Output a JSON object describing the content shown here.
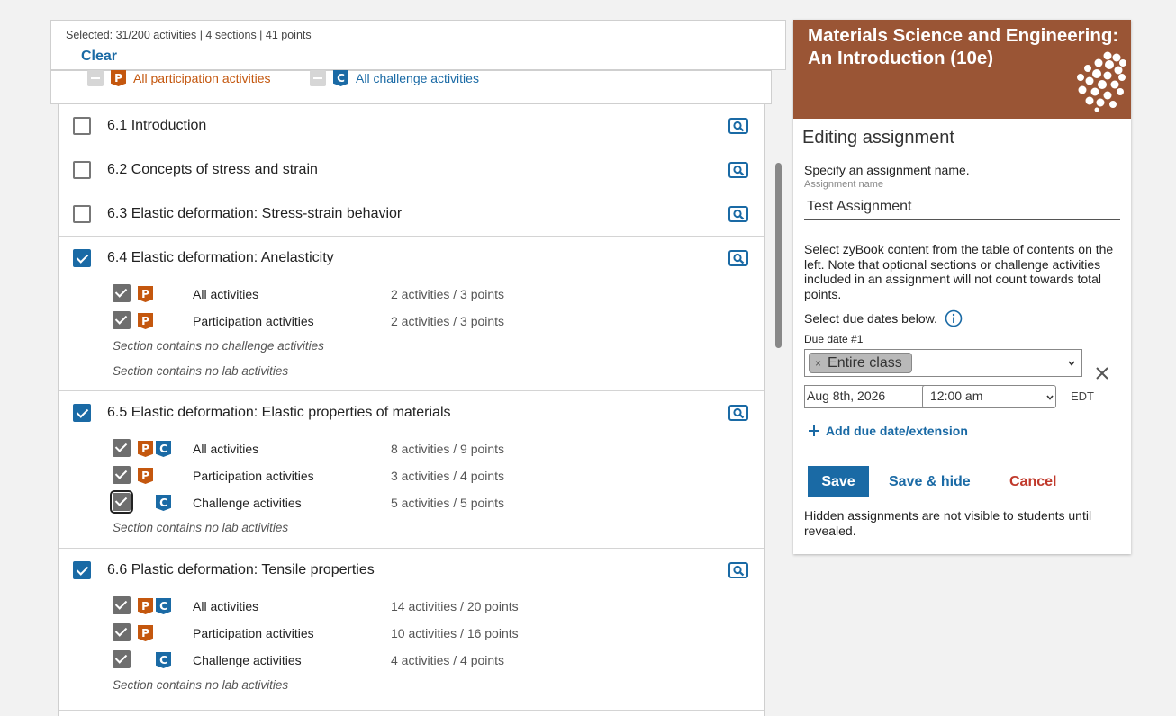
{
  "selection": {
    "summary": "Selected: 31/200 activities | 4 sections | 41 points",
    "clear_label": "Clear"
  },
  "filters": {
    "participation_label": "All participation activities",
    "challenge_label": "All challenge activities",
    "participation_badge": "P",
    "challenge_badge": "C",
    "participation_color": "#c4570e",
    "challenge_color": "#1a6aa5"
  },
  "sections": [
    {
      "title": "6.1 Introduction",
      "checked": false
    },
    {
      "title": "6.2 Concepts of stress and strain",
      "checked": false
    },
    {
      "title": "6.3 Elastic deformation: Stress-strain behavior",
      "checked": false
    },
    {
      "title": "6.4 Elastic deformation: Anelasticity",
      "checked": true,
      "activities": [
        {
          "label": "All activities",
          "count": "2 activities / 3 points"
        },
        {
          "label": "Participation activities",
          "count": "2 activities / 3 points"
        }
      ],
      "notes": [
        "Section contains no challenge activities",
        "Section contains no lab activities"
      ]
    },
    {
      "title": "6.5 Elastic deformation: Elastic properties of materials",
      "checked": true,
      "activities": [
        {
          "label": "All activities",
          "count": "8 activities / 9 points"
        },
        {
          "label": "Participation activities",
          "count": "3 activities / 4 points"
        },
        {
          "label": "Challenge activities",
          "count": "5 activities / 5 points"
        }
      ],
      "notes": [
        "Section contains no lab activities"
      ]
    },
    {
      "title": "6.6 Plastic deformation: Tensile properties",
      "checked": true,
      "activities": [
        {
          "label": "All activities",
          "count": "14 activities / 20 points"
        },
        {
          "label": "Participation activities",
          "count": "10 activities / 16 points"
        },
        {
          "label": "Challenge activities",
          "count": "4 activities / 4 points"
        }
      ],
      "notes": [
        "Section contains no lab activities"
      ]
    }
  ],
  "panel": {
    "book_title": "Materials Science and Engineering: An Introduction (10e)",
    "book_color": "#9a5535",
    "heading": "Editing assignment",
    "specify_label": "Specify an assignment name.",
    "field_label": "Assignment name",
    "assignment_name": "Test Assignment",
    "instructions": "Select zyBook content from the table of contents on the left. Note that optional sections or challenge activities included in an assignment will not count towards total points.",
    "due_dates_label": "Select due dates below.",
    "due_date_number": "Due date #1",
    "class_chip": "Entire class",
    "chip_remove": "×",
    "date_value": "Aug 8th, 2026",
    "time_value": "12:00 am",
    "timezone": "EDT",
    "add_due_label": "Add due date/extension",
    "save_label": "Save",
    "save_hide_label": "Save & hide",
    "cancel_label": "Cancel",
    "hidden_note": "Hidden assignments are not visible to students until revealed."
  }
}
